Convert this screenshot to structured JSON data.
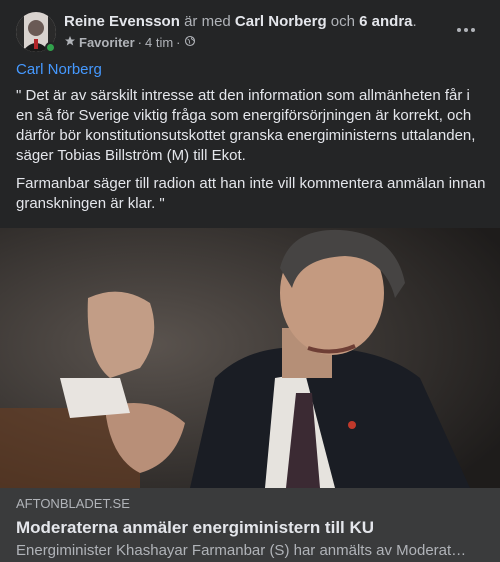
{
  "post": {
    "author": "Reine Evensson",
    "with_text": "är med",
    "tagged_person": "Carl Norberg",
    "and_text": "och",
    "others": "6 andra",
    "period": ".",
    "audience": "Favoriter",
    "separator": "·",
    "time": "4 tim",
    "separator2": "·",
    "mention": "Carl Norberg",
    "paragraphs": [
      "\" Det är av särskilt intresse att den information som allmänheten får i en så för Sverige viktig fråga som energiförsörjningen är korrekt, och därför bör konstitutionsutskottet granska energiministerns uttalanden, säger Tobias Billström (M) till Ekot.",
      "Farmanbar säger till radion att han inte vill kommentera anmälan innan granskningen är klar. \""
    ]
  },
  "link": {
    "source": "AFTONBLADET.SE",
    "title": "Moderaterna anmäler energiministern till KU",
    "description": "Energiminister Khashayar Farmanbar (S) har anmälts av Moderat…"
  },
  "icons": {
    "audience": "star-icon",
    "privacy": "globe-icon",
    "menu": "more-options-icon"
  },
  "colors": {
    "background": "#242526",
    "link_card": "#3a3b3c",
    "mention": "#4599ff",
    "online": "#31a24c"
  }
}
